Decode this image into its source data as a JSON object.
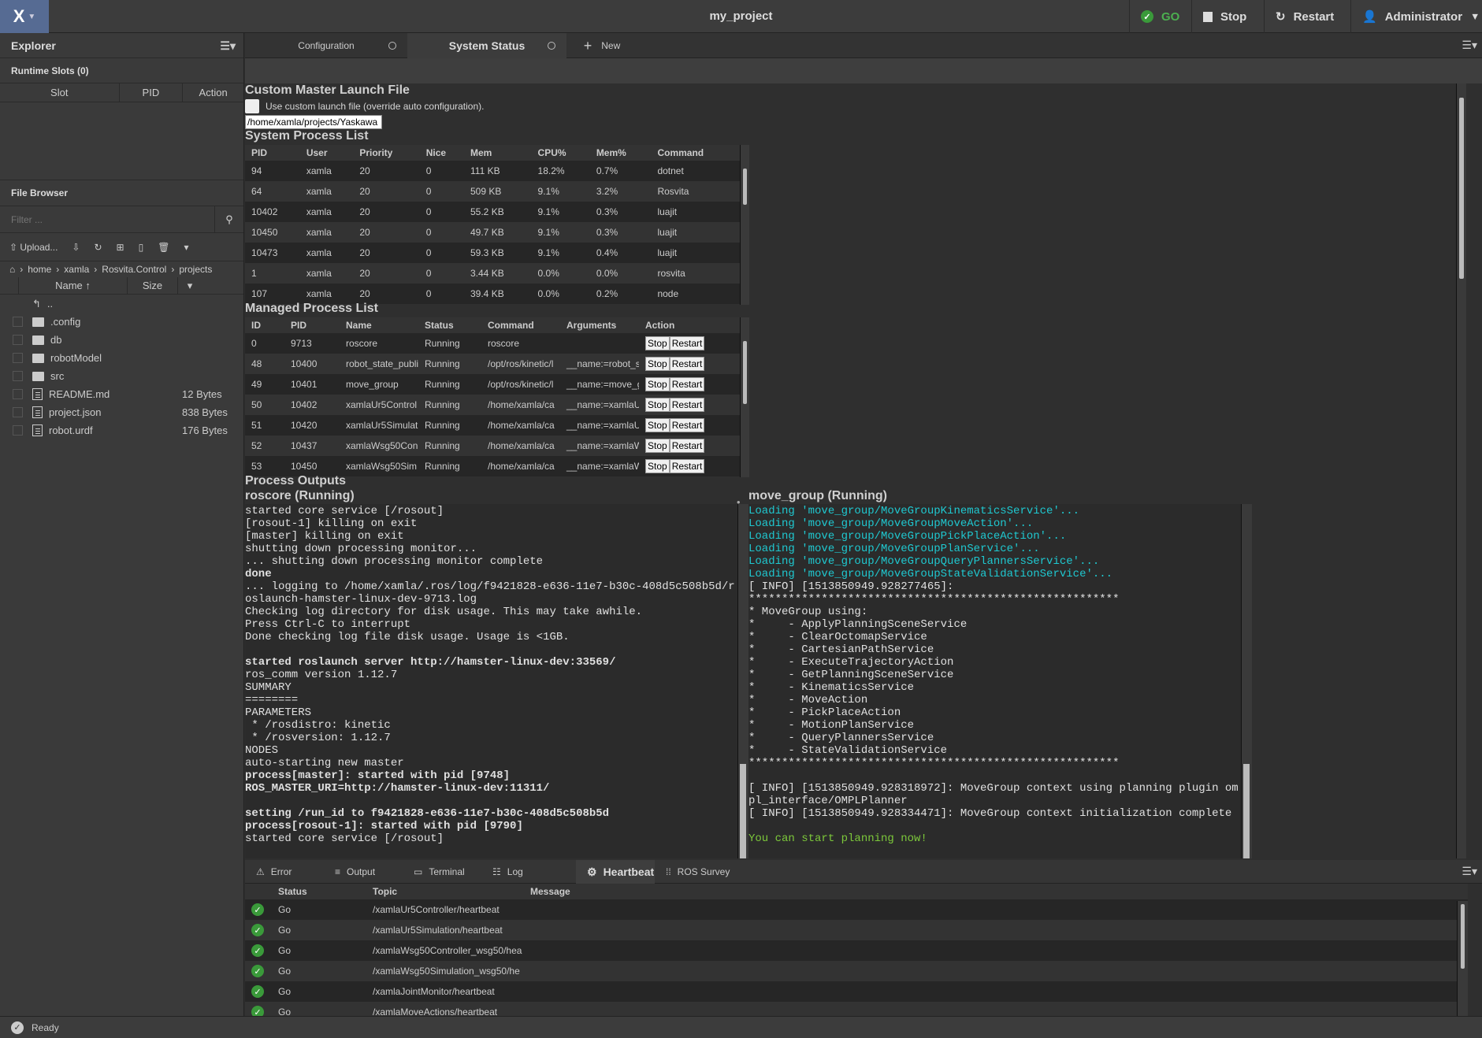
{
  "app": {
    "title": "my_project",
    "go_label": "GO",
    "stop_label": "Stop",
    "restart_label": "Restart",
    "user": "Administrator",
    "accent": "#566b93",
    "ok_color": "#3a9a3a"
  },
  "explorer": {
    "title": "Explorer",
    "runtime_slots": "Runtime Slots (0)",
    "slot_cols": [
      "Slot",
      "PID",
      "Action"
    ]
  },
  "file_browser": {
    "title": "File Browser",
    "filter_placeholder": "Filter ...",
    "upload_label": "Upload...",
    "breadcrumb": [
      "home",
      "xamla",
      "Rosvita.Control",
      "projects"
    ],
    "col_name": "Name",
    "col_size": "Size",
    "parent": "..",
    "items": [
      {
        "name": ".config",
        "type": "folder",
        "size": ""
      },
      {
        "name": "db",
        "type": "folder",
        "size": ""
      },
      {
        "name": "robotModel",
        "type": "folder",
        "size": ""
      },
      {
        "name": "src",
        "type": "folder",
        "size": ""
      },
      {
        "name": "README.md",
        "type": "file",
        "size": "12 Bytes"
      },
      {
        "name": "project.json",
        "type": "file",
        "size": "838 Bytes"
      },
      {
        "name": "robot.urdf",
        "type": "file",
        "size": "176 Bytes"
      }
    ]
  },
  "tabs": [
    {
      "label": "Configuration"
    },
    {
      "label": "System Status",
      "active": true
    }
  ],
  "new_tab": "New",
  "launch": {
    "heading": "Custom Master Launch File",
    "checkbox_label": "Use custom launch file (override auto configuration).",
    "path": "/home/xamla/projects/Yaskawa",
    "checked": false
  },
  "system_processes": {
    "heading": "System Process List",
    "columns": [
      "PID",
      "User",
      "Priority",
      "Nice",
      "Mem",
      "CPU%",
      "Mem%",
      "Command"
    ],
    "rows": [
      [
        "94",
        "xamla",
        "20",
        "0",
        "111 KB",
        "18.2%",
        "0.7%",
        "dotnet"
      ],
      [
        "64",
        "xamla",
        "20",
        "0",
        "509 KB",
        "9.1%",
        "3.2%",
        "Rosvita"
      ],
      [
        "10402",
        "xamla",
        "20",
        "0",
        "55.2 KB",
        "9.1%",
        "0.3%",
        "luajit"
      ],
      [
        "10450",
        "xamla",
        "20",
        "0",
        "49.7 KB",
        "9.1%",
        "0.3%",
        "luajit"
      ],
      [
        "10473",
        "xamla",
        "20",
        "0",
        "59.3 KB",
        "9.1%",
        "0.4%",
        "luajit"
      ],
      [
        "1",
        "xamla",
        "20",
        "0",
        "3.44 KB",
        "0.0%",
        "0.0%",
        "rosvita"
      ],
      [
        "107",
        "xamla",
        "20",
        "0",
        "39.4 KB",
        "0.0%",
        "0.2%",
        "node"
      ]
    ]
  },
  "managed_processes": {
    "heading": "Managed Process List",
    "columns": [
      "ID",
      "PID",
      "Name",
      "Status",
      "Command",
      "Arguments",
      "Action"
    ],
    "stop_label": "Stop",
    "restart_label": "Restart",
    "rows": [
      [
        "0",
        "9713",
        "roscore",
        "Running",
        "roscore",
        ""
      ],
      [
        "48",
        "10400",
        "robot_state_publi",
        "Running",
        "/opt/ros/kinetic/l",
        "__name:=robot_st"
      ],
      [
        "49",
        "10401",
        "move_group",
        "Running",
        "/opt/ros/kinetic/l",
        "__name:=move_g"
      ],
      [
        "50",
        "10402",
        "xamlaUr5Control",
        "Running",
        "/home/xamla/ca",
        "__name:=xamlaU"
      ],
      [
        "51",
        "10420",
        "xamlaUr5Simulat",
        "Running",
        "/home/xamla/ca",
        "__name:=xamlaU"
      ],
      [
        "52",
        "10437",
        "xamlaWsg50Con",
        "Running",
        "/home/xamla/ca",
        "__name:=xamlaW"
      ],
      [
        "53",
        "10450",
        "xamlaWsg50Sim",
        "Running",
        "/home/xamla/ca",
        "__name:=xamlaW"
      ]
    ]
  },
  "outputs": {
    "heading": "Process Outputs",
    "left": {
      "title": "roscore (Running)",
      "lines": [
        {
          "t": "started core service [/rosout]"
        },
        {
          "t": "[rosout-1] killing on exit"
        },
        {
          "t": "[master] killing on exit"
        },
        {
          "t": "shutting down processing monitor..."
        },
        {
          "t": "... shutting down processing monitor complete"
        },
        {
          "t": "done",
          "s": "bold"
        },
        {
          "t": "... logging to /home/xamla/.ros/log/f9421828-e636-11e7-b30c-408d5c508b5d/r"
        },
        {
          "t": "oslaunch-hamster-linux-dev-9713.log"
        },
        {
          "t": "Checking log directory for disk usage. This may take awhile."
        },
        {
          "t": "Press Ctrl-C to interrupt"
        },
        {
          "t": "Done checking log file disk usage. Usage is <1GB."
        },
        {
          "t": ""
        },
        {
          "t": "started roslaunch server http://hamster-linux-dev:33569/",
          "s": "bold"
        },
        {
          "t": "ros_comm version 1.12.7"
        },
        {
          "t": "SUMMARY"
        },
        {
          "t": "========"
        },
        {
          "t": "PARAMETERS"
        },
        {
          "t": " * /rosdistro: kinetic"
        },
        {
          "t": " * /rosversion: 1.12.7"
        },
        {
          "t": "NODES"
        },
        {
          "t": "auto-starting new master"
        },
        {
          "t": "process[master]: started with pid [9748]",
          "s": "bold"
        },
        {
          "t": "ROS_MASTER_URI=http://hamster-linux-dev:11311/",
          "s": "bold"
        },
        {
          "t": ""
        },
        {
          "t": "setting /run_id to f9421828-e636-11e7-b30c-408d5c508b5d",
          "s": "bold"
        },
        {
          "t": "process[rosout-1]: started with pid [9790]",
          "s": "bold"
        },
        {
          "t": "started core service [/rosout]"
        }
      ]
    },
    "right": {
      "title": "move_group (Running)",
      "lines": [
        {
          "t": "Loading 'move_group/MoveGroupKinematicsService'...",
          "s": "cyan"
        },
        {
          "t": "Loading 'move_group/MoveGroupMoveAction'...",
          "s": "cyan"
        },
        {
          "t": "Loading 'move_group/MoveGroupPickPlaceAction'...",
          "s": "cyan"
        },
        {
          "t": "Loading 'move_group/MoveGroupPlanService'...",
          "s": "cyan"
        },
        {
          "t": "Loading 'move_group/MoveGroupQueryPlannersService'...",
          "s": "cyan"
        },
        {
          "t": "Loading 'move_group/MoveGroupStateValidationService'...",
          "s": "cyan"
        },
        {
          "t": "[ INFO] [1513850949.928277465]:"
        },
        {
          "t": "********************************************************"
        },
        {
          "t": "* MoveGroup using:"
        },
        {
          "t": "*     - ApplyPlanningSceneService"
        },
        {
          "t": "*     - ClearOctomapService"
        },
        {
          "t": "*     - CartesianPathService"
        },
        {
          "t": "*     - ExecuteTrajectoryAction"
        },
        {
          "t": "*     - GetPlanningSceneService"
        },
        {
          "t": "*     - KinematicsService"
        },
        {
          "t": "*     - MoveAction"
        },
        {
          "t": "*     - PickPlaceAction"
        },
        {
          "t": "*     - MotionPlanService"
        },
        {
          "t": "*     - QueryPlannersService"
        },
        {
          "t": "*     - StateValidationService"
        },
        {
          "t": "********************************************************"
        },
        {
          "t": ""
        },
        {
          "t": "[ INFO] [1513850949.928318972]: MoveGroup context using planning plugin om"
        },
        {
          "t": "pl_interface/OMPLPlanner"
        },
        {
          "t": "[ INFO] [1513850949.928334471]: MoveGroup context initialization complete"
        },
        {
          "t": ""
        },
        {
          "t": "You can start planning now!",
          "s": "green"
        }
      ]
    }
  },
  "bottom_tabs": [
    {
      "label": "Error",
      "icon": "warning-icon"
    },
    {
      "label": "Output",
      "icon": "lines-icon"
    },
    {
      "label": "Terminal",
      "icon": "terminal-icon"
    },
    {
      "label": "Log",
      "icon": "log-icon"
    },
    {
      "label": "Heartbeat",
      "icon": "heartbeat-icon",
      "active": true
    },
    {
      "label": "ROS Survey",
      "icon": "grid-icon"
    }
  ],
  "heartbeat": {
    "columns": [
      "Status",
      "Topic",
      "Message"
    ],
    "rows": [
      [
        "Go",
        "/xamlaUr5Controller/heartbeat",
        ""
      ],
      [
        "Go",
        "/xamlaUr5Simulation/heartbeat",
        ""
      ],
      [
        "Go",
        "/xamlaWsg50Controller_wsg50/hea",
        ""
      ],
      [
        "Go",
        "/xamlaWsg50Simulation_wsg50/he",
        ""
      ],
      [
        "Go",
        "/xamlaJointMonitor/heartbeat",
        ""
      ],
      [
        "Go",
        "/xamlaMoveActions/heartbeat",
        ""
      ]
    ]
  },
  "status_bar": {
    "text": "Ready"
  }
}
